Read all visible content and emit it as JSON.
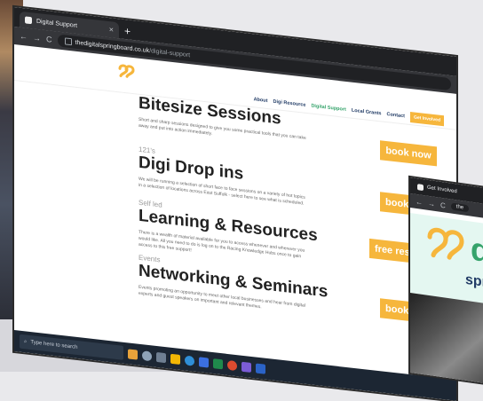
{
  "browser": {
    "tab_title": "Digital Support",
    "tab_close": "×",
    "new_tab": "+",
    "url_domain": "thedigitalspringboard.co.uk",
    "url_path": "/digital-support",
    "nav_back": "←",
    "nav_forward": "→",
    "nav_reload": "C"
  },
  "site": {
    "nav": [
      "About",
      "Digi Resource",
      "Digital Support",
      "Local Grants",
      "Contact"
    ],
    "nav_current_index": 2,
    "nav_button": "Get Involved"
  },
  "sections": [
    {
      "kicker": "",
      "title": "Bitesize Sessions",
      "desc": "Short and sharp sessions designed to give you some practical tools that you can take away and put into action immediately.",
      "button": "book now"
    },
    {
      "kicker": "121's",
      "title": "Digi Drop ins",
      "desc": "We will be running a selection of short face to face sessions on a variety of hot topics in a selection of locations across East Suffolk - select here to see what is scheduled.",
      "button": "book"
    },
    {
      "kicker": "Self led",
      "title": "Learning & Resources",
      "desc": "There is a wealth of material available for you to access whenever and wherever you would like. All you need to do is log on to the Racing Knowledge Hubs once to gain access to this free support!",
      "button": "free res"
    },
    {
      "kicker": "Events",
      "title": "Networking & Seminars",
      "desc": "Events promoting an opportunity to meet other local businesses and hear from digital experts and guest speakers on important and relevant themes.",
      "button": "book"
    }
  ],
  "taskbar": {
    "search_placeholder": "Type here to search"
  },
  "window2": {
    "tab_title": "Get Involved",
    "brand_big": "d",
    "brand_small": "spr",
    "nav_back": "←",
    "nav_forward": "→",
    "nav_reload": "C",
    "url_prefix": "the"
  },
  "colors": {
    "accent": "#f6b63c",
    "brand_green": "#35a36b",
    "brand_navy": "#223c66"
  }
}
